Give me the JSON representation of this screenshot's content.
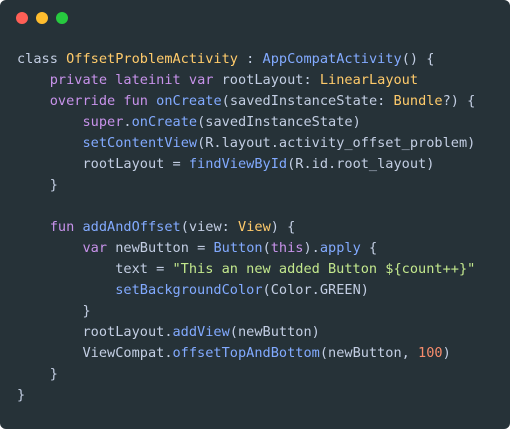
{
  "window": {
    "controls": [
      {
        "name": "close-button",
        "color": "#ff5f56"
      },
      {
        "name": "minimize-button",
        "color": "#ffbd2e"
      },
      {
        "name": "maximize-button",
        "color": "#27c93f"
      }
    ]
  },
  "colors": {
    "background": "#263238",
    "plain": "#c3cee3",
    "keyword": "#c792ea",
    "function": "#82aaff",
    "type": "#ffcb6b",
    "string": "#c3e88d",
    "number": "#f78c6c",
    "punct": "#89ddff"
  },
  "code": {
    "language": "kotlin",
    "lines": [
      [
        [
          "plain",
          "class "
        ],
        [
          "type",
          "OffsetProblemActivity"
        ],
        [
          "plain",
          " : "
        ],
        [
          "function",
          "AppCompatActivity"
        ],
        [
          "plain",
          "() {"
        ]
      ],
      [
        [
          "plain",
          "    "
        ],
        [
          "keyword",
          "private lateinit var "
        ],
        [
          "plain",
          "rootLayout: "
        ],
        [
          "type",
          "LinearLayout"
        ]
      ],
      [
        [
          "plain",
          "    "
        ],
        [
          "keyword",
          "override fun "
        ],
        [
          "function",
          "onCreate"
        ],
        [
          "plain",
          "(savedInstanceState: "
        ],
        [
          "type",
          "Bundle"
        ],
        [
          "plain",
          "?) {"
        ]
      ],
      [
        [
          "plain",
          "        "
        ],
        [
          "keyword",
          "super"
        ],
        [
          "plain",
          "."
        ],
        [
          "function",
          "onCreate"
        ],
        [
          "plain",
          "(savedInstanceState)"
        ]
      ],
      [
        [
          "plain",
          "        "
        ],
        [
          "function",
          "setContentView"
        ],
        [
          "plain",
          "(R.layout.activity_offset_problem)"
        ]
      ],
      [
        [
          "plain",
          "        rootLayout = "
        ],
        [
          "function",
          "findViewById"
        ],
        [
          "plain",
          "(R.id.root_layout)"
        ]
      ],
      [
        [
          "plain",
          "    }"
        ]
      ],
      [
        [
          "plain",
          ""
        ]
      ],
      [
        [
          "plain",
          "    "
        ],
        [
          "keyword",
          "fun "
        ],
        [
          "function",
          "addAndOffset"
        ],
        [
          "plain",
          "(view: "
        ],
        [
          "type",
          "View"
        ],
        [
          "plain",
          ") {"
        ]
      ],
      [
        [
          "plain",
          "        "
        ],
        [
          "keyword",
          "var "
        ],
        [
          "plain",
          "newButton = "
        ],
        [
          "function",
          "Button"
        ],
        [
          "plain",
          "("
        ],
        [
          "keyword",
          "this"
        ],
        [
          "plain",
          ")."
        ],
        [
          "function",
          "apply"
        ],
        [
          "plain",
          " {"
        ]
      ],
      [
        [
          "plain",
          "            text = "
        ],
        [
          "string",
          "\"This an new added Button ${count++}\""
        ]
      ],
      [
        [
          "plain",
          "            "
        ],
        [
          "function",
          "setBackgroundColor"
        ],
        [
          "plain",
          "(Color.GREEN)"
        ]
      ],
      [
        [
          "plain",
          "        }"
        ]
      ],
      [
        [
          "plain",
          "        rootLayout."
        ],
        [
          "function",
          "addView"
        ],
        [
          "plain",
          "(newButton)"
        ]
      ],
      [
        [
          "plain",
          "        ViewCompat."
        ],
        [
          "function",
          "offsetTopAndBottom"
        ],
        [
          "plain",
          "(newButton, "
        ],
        [
          "number",
          "100"
        ],
        [
          "plain",
          ")"
        ]
      ],
      [
        [
          "plain",
          "    }"
        ]
      ],
      [
        [
          "plain",
          "}"
        ]
      ]
    ]
  }
}
